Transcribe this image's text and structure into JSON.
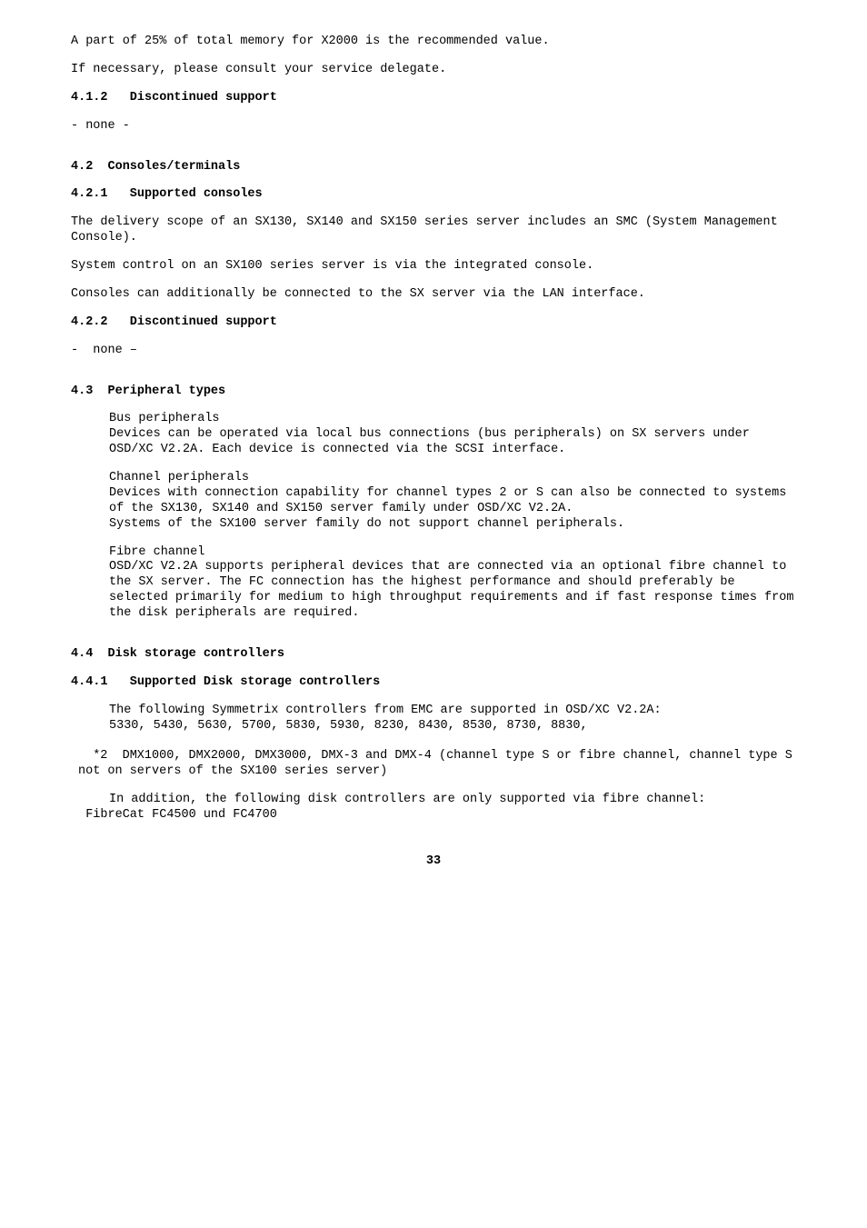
{
  "p1": "A part of 25% of total memory for X2000 is the recommended value.",
  "p2": "If necessary, please consult your service delegate.",
  "h412": "4.1.2   Discontinued support",
  "p3": "- none -",
  "h42": "4.2  Consoles/terminals",
  "h421": "4.2.1   Supported consoles",
  "p4": "The delivery scope of an SX130, SX140 and SX150 series server includes an SMC (System Management Console).",
  "p5": "System control on an SX100 series server is via the integrated console.",
  "p6": "Consoles can additionally be connected to the SX server via the LAN interface.",
  "h422": "4.2.2   Discontinued support",
  "p7": "-  none –",
  "h43": "4.3  Peripheral types",
  "p8a": "Bus peripherals",
  "p8b": "Devices can be operated via local bus connections (bus peripherals) on SX servers under OSD/XC V2.2A. Each device is connected via the SCSI interface.",
  "p9a": "Channel peripherals",
  "p9b": "Devices with connection capability for channel types 2 or S can also be connected to systems of the SX130, SX140 and SX150 server family under OSD/XC V2.2A.",
  "p9c": "Systems of the SX100 server family do not support channel peripherals.",
  "p10a": "Fibre channel",
  "p10b": "OSD/XC V2.2A supports peripheral devices that are connected via an optional fibre channel to the SX server. The FC connection has the highest performance and should preferably be selected primarily for medium to high throughput requirements and if fast response times from the disk peripherals are required.",
  "h44": "4.4  Disk storage controllers",
  "h441": "4.4.1   Supported Disk storage controllers",
  "p11": "The following Symmetrix controllers from EMC are supported in OSD/XC V2.2A:",
  "p12": "5330, 5430, 5630, 5700, 5830, 5930, 8230, 8430, 8530, 8730, 8830,",
  "p13pre": "*2  ",
  "p13": "DMX1000, DMX2000, DMX3000, DMX-3 and DMX-4 (channel type S or fibre channel, channel type S not on servers of the SX100 series server)",
  "p14": "In addition, the following disk controllers are only supported via fibre channel:",
  "p15": "  FibreCat FC4500 und FC4700",
  "pagenum": "33"
}
